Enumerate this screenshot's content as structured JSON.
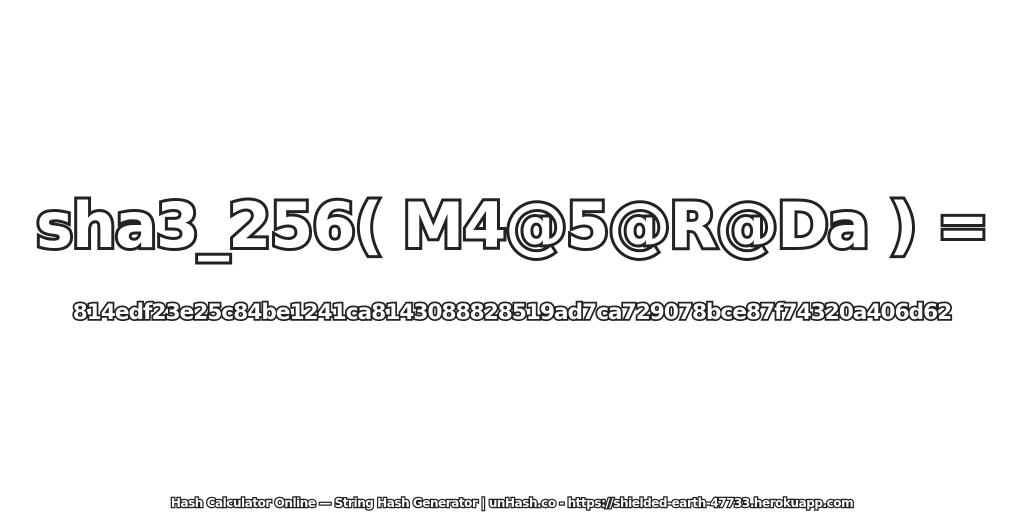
{
  "expression": "sha3_256( M4@5@R@Da ) =",
  "hash_value": "814edf23e25c84be1241ca8143088828519ad7ca729078bce87f74320a406d62",
  "footer": {
    "text": "Hash Calculator Online — String Hash Generator | unHash.co - https://shielded-earth-47733.herokuapp.com"
  },
  "colors": {
    "background": "#ffffff",
    "text_fill": "#ffffff",
    "text_outline": "#222222"
  }
}
